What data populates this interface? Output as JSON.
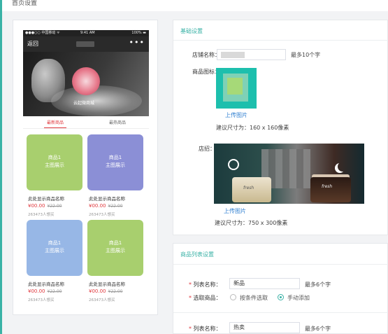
{
  "page_title": "首页设置",
  "phone": {
    "status": {
      "carrier": "●●●○○ 中国移动 ᯤ",
      "time": "9:41 AM",
      "battery": "100% ▬"
    },
    "nav": {
      "back": "返回",
      "more": "•••"
    },
    "banner_label": "云起微商城",
    "tabs": [
      "最新商品",
      "最热商品"
    ],
    "products": [
      {
        "placeholder_line1": "商品1",
        "placeholder_line2": "主图展示",
        "name": "此处显示商品名称",
        "price": "¥00.00",
        "old_price": "¥22.00",
        "sold": "263473人想买",
        "color": "#a8cf6e"
      },
      {
        "placeholder_line1": "商品1",
        "placeholder_line2": "主图展示",
        "name": "此处显示商品名称",
        "price": "¥00.00",
        "old_price": "¥22.00",
        "sold": "263473人想买",
        "color": "#8b8fd6"
      },
      {
        "placeholder_line1": "商品1",
        "placeholder_line2": "主图展示",
        "name": "此处显示商品名称",
        "price": "¥00.00",
        "old_price": "¥22.00",
        "sold": "263473人想买",
        "color": "#97b7e6"
      },
      {
        "placeholder_line1": "商品1",
        "placeholder_line2": "主图展示",
        "name": "此处显示商品名称",
        "price": "¥00.00",
        "old_price": "¥22.00",
        "sold": "263473人想买",
        "color": "#a8cf6e"
      }
    ]
  },
  "basic": {
    "title": "基础设置",
    "store_name_label": "店铺名称：",
    "store_name_value": "",
    "store_name_hint": "最多10个字",
    "icon_label": "商品图标：",
    "icon_upload": "上传图片",
    "icon_size": "建议尺寸为：160 x 160像素",
    "sign_label": "店招：",
    "sign_brand1": "fresh",
    "sign_brand2": "fresh",
    "sign_upload": "上传图片",
    "sign_size": "建议尺寸为：750 x 300像素"
  },
  "list": {
    "title": "商品列表设置",
    "req_mark": "*",
    "name_label": "列表名称：",
    "name_value": "新品",
    "name_hint": "最多6个字",
    "select_label": "选取商品：",
    "opt_condition": "按条件选取",
    "opt_manual": "手动添加",
    "selected": "manual",
    "name2_label": "列表名称：",
    "name2_value": "热卖",
    "name2_hint": "最多6个字"
  }
}
